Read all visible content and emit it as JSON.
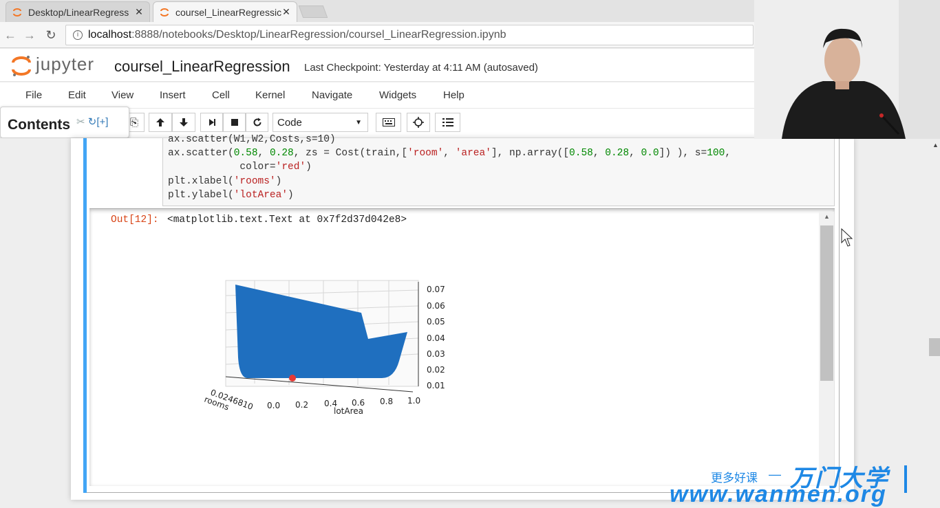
{
  "browser": {
    "tabs": [
      {
        "title": "Desktop/LinearRegress",
        "icon": "jupyter-tab-icon",
        "active": false
      },
      {
        "title": "coursel_LinearRegressic",
        "icon": "jupyter-tab-icon",
        "active": true
      }
    ],
    "url_host": "localhost",
    "url_rest": ":8888/notebooks/Desktop/LinearRegression/coursel_LinearRegression.ipynb"
  },
  "jupyter": {
    "logo_text": "jupyter",
    "notebook_name": "coursel_LinearRegression",
    "checkpoint": "Last Checkpoint: Yesterday at 4:11 AM (autosaved)"
  },
  "menu": [
    "File",
    "Edit",
    "View",
    "Insert",
    "Cell",
    "Kernel",
    "Navigate",
    "Widgets",
    "Help"
  ],
  "toolbar": {
    "cell_type": "Code"
  },
  "toc": {
    "title": "Contents",
    "toggle_label": "[+]"
  },
  "cell": {
    "code_lines": [
      "ax.scatter(W1,W2,Costs,s=10)",
      "ax.scatter(0.58, 0.28, zs = Cost(train,['room', 'area'], np.array([0.58, 0.28, 0.0]) ), s=100,",
      "            color='red')",
      "plt.xlabel('rooms')",
      "plt.ylabel('lotArea')"
    ],
    "out_prompt": "Out[12]:",
    "out_text": "<matplotlib.text.Text at 0x7f2d37d042e8>"
  },
  "chart_data": {
    "type": "scatter3d",
    "xlabel": "rooms",
    "ylabel": "lotArea",
    "x_ticks": [
      "0.0",
      "0.2",
      "0.4",
      "0.6",
      "0.8",
      "1.0"
    ],
    "y_ticks_overlapped": "0.0246810",
    "z_ticks": [
      "0.07",
      "0.06",
      "0.05",
      "0.04",
      "0.03",
      "0.02",
      "0.01"
    ],
    "surface_color": "#1f6fbf",
    "highlight_point": {
      "x": 0.58,
      "y": 0.28,
      "color": "red"
    }
  },
  "watermark": {
    "small": "更多好课",
    "dash": "—",
    "big": "万门大学",
    "url": "www.wanmen.org",
    "color": "#1e88e5"
  }
}
